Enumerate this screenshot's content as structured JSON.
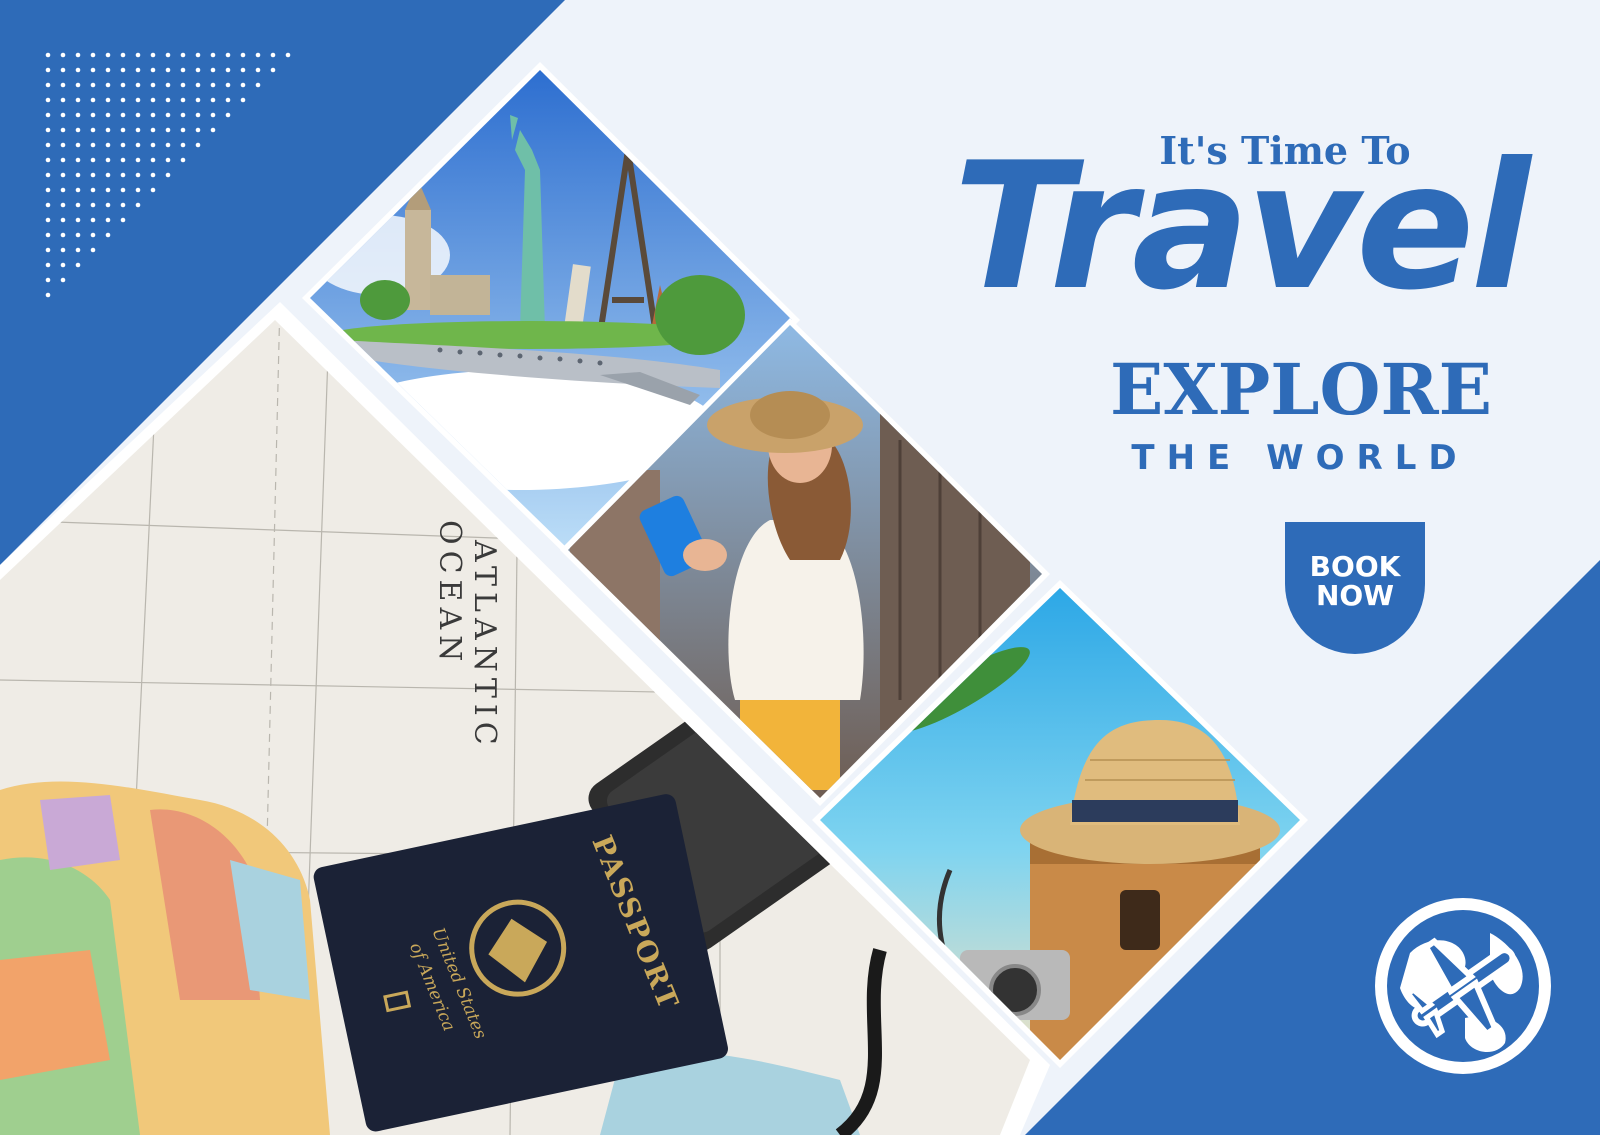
{
  "poster": {
    "tagline": "It's Time To",
    "headline": "Travel",
    "subhead": "EXPLORE",
    "subhead2": "THE WORLD",
    "cta": {
      "line1": "BOOK",
      "line2": "NOW"
    }
  },
  "photos": {
    "map": {
      "ocean_label_1": "ATLANTIC",
      "ocean_label_2": "OCEAN"
    },
    "passport": {
      "title": "PASSPORT",
      "country_1": "United States",
      "country_2": "of America"
    }
  },
  "colors": {
    "brand": "#2e6bb8",
    "background": "#eef3fa",
    "white": "#ffffff"
  },
  "icons": {
    "globe": "globe-airplane-icon"
  }
}
